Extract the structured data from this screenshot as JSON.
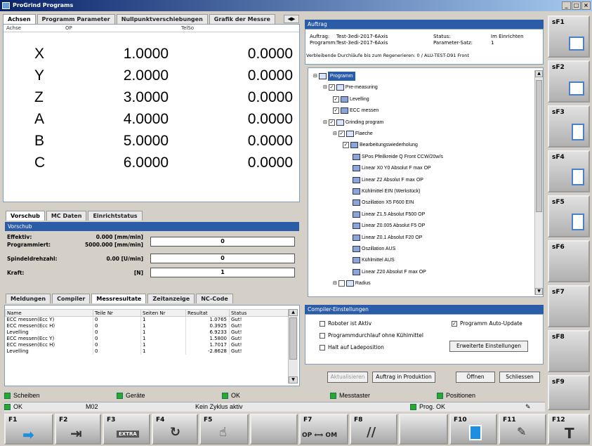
{
  "window": {
    "title": "ProGrind Programs"
  },
  "left_tabs": [
    "Achsen",
    "Programm Parameter",
    "Nullpunktverschiebungen",
    "Grafik der Messre"
  ],
  "axes_table": {
    "headers": [
      "Achse",
      "OP",
      "TelSo"
    ],
    "rows": [
      {
        "axis": "X",
        "op": "1.0000",
        "target": "0.0000"
      },
      {
        "axis": "Y",
        "op": "2.0000",
        "target": "0.0000"
      },
      {
        "axis": "Z",
        "op": "3.0000",
        "target": "0.0000"
      },
      {
        "axis": "A",
        "op": "4.0000",
        "target": "0.0000"
      },
      {
        "axis": "B",
        "op": "5.0000",
        "target": "0.0000"
      },
      {
        "axis": "C",
        "op": "6.0000",
        "target": "0.0000"
      }
    ]
  },
  "feed_tabs": [
    "Vorschub",
    "MC Daten",
    "Einrichtstatus"
  ],
  "feed": {
    "header": "Vorschub",
    "rows": [
      {
        "label": "Effektiv:",
        "value": "0.000 [mm/min]"
      },
      {
        "label": "Programmiert:",
        "value": "5000.000 [mm/min]",
        "box": "0"
      },
      {
        "label": "Spindeldrehzahl:",
        "value": "0.00 [U/min]",
        "box": "0"
      },
      {
        "label": "Kraft:",
        "value": "[N]",
        "box": "1"
      }
    ]
  },
  "bottom_tabs": [
    "Meldungen",
    "Compiler",
    "Messresultate",
    "Zeitanzeige",
    "NC-Code"
  ],
  "measure_table": {
    "headers": [
      "Name",
      "Teile Nr",
      "Seiten Nr",
      "Resultat",
      "Status"
    ],
    "rows": [
      [
        "ECC messen(Ecc Y)",
        "0",
        "1",
        "1.0765",
        "Gut!"
      ],
      [
        "ECC messen(Ecc H)",
        "0",
        "1",
        "0.3925",
        "Gut!"
      ],
      [
        "Levelling",
        "0",
        "1",
        "6.9233",
        "Gut!"
      ],
      [
        "ECC messen(Ecc Y)",
        "0",
        "1",
        "1.5800",
        "Gut!"
      ],
      [
        "ECC messen(Ecc H)",
        "0",
        "1",
        "1.7017",
        "Gut!"
      ],
      [
        "Levelling",
        "0",
        "1",
        "-2.8628",
        "Gut!"
      ]
    ]
  },
  "order": {
    "header": "Auftrag",
    "auftrag_label": "Auftrag:",
    "auftrag_value": "Test-3edi-2017-6Axis",
    "programm_label": "Programm:",
    "programm_value": "Test-3edi-2017-6Axis",
    "status_label": "Status:",
    "status_value": "Im Einrichten",
    "paramset_label": "Parameter-Satz:",
    "paramset_value": "1",
    "cycles_text": "Verbleibende Durchläufe bis zum Regenerieren: 0 / ALU-TEST-D91 Front"
  },
  "tree": [
    {
      "label": "Programm",
      "level": 0,
      "selected": true,
      "kind": "folder"
    },
    {
      "label": "Pre-measuring",
      "level": 1,
      "checked": true,
      "kind": "folder"
    },
    {
      "label": "Levelling",
      "level": 2,
      "checked": true,
      "kind": "op"
    },
    {
      "label": "ECC messen",
      "level": 2,
      "checked": true,
      "kind": "op"
    },
    {
      "label": "Grinding program",
      "level": 1,
      "checked": true,
      "kind": "folder"
    },
    {
      "label": "Flaeche",
      "level": 2,
      "checked": true,
      "kind": "folder"
    },
    {
      "label": "Bearbeitungswiederholung",
      "level": 3,
      "checked": true,
      "kind": "op"
    },
    {
      "label": "SPos Pfeilkreide Q Front CCW/20w/s",
      "level": 4,
      "kind": "op"
    },
    {
      "label": "Linear X0 Y0 Absolut F max OP",
      "level": 4,
      "kind": "op"
    },
    {
      "label": "Linear Z2 Absolut F max OP",
      "level": 4,
      "kind": "op"
    },
    {
      "label": "Kühlmittel EIN (Werkstück)",
      "level": 4,
      "kind": "op"
    },
    {
      "label": "Oszillation X5 F600 EIN",
      "level": 4,
      "kind": "op"
    },
    {
      "label": "Linear Z1.5 Absolut F500 OP",
      "level": 4,
      "kind": "op"
    },
    {
      "label": "Linear Z0.005 Absolut F5 OP",
      "level": 4,
      "kind": "op"
    },
    {
      "label": "Linear Z0.1 Absolut F20 OP",
      "level": 4,
      "kind": "op"
    },
    {
      "label": "Oszillation AUS",
      "level": 4,
      "kind": "op"
    },
    {
      "label": "Kühlmittel AUS",
      "level": 4,
      "kind": "op"
    },
    {
      "label": "Linear Z20 Absolut F max OP",
      "level": 4,
      "kind": "op"
    },
    {
      "label": "Radius",
      "level": 2,
      "checked": false,
      "kind": "folder"
    }
  ],
  "compiler": {
    "header": "Compiler-Einstellungen",
    "roboter": "Roboter ist Aktiv",
    "auto_update": "Programm Auto-Update",
    "ohne_kuehl": "Programmdurchlauf ohne Kühlmittel",
    "halt": "Halt auf Ladeposition",
    "advanced_btn": "Erweiterte Einstellungen"
  },
  "order_buttons": {
    "aktualisieren": "Aktualisieren",
    "produktion": "Auftrag in Produktion",
    "oeffnen": "Öffnen",
    "schliessen": "Schliessen"
  },
  "status1": {
    "scheiben": "Scheiben",
    "geraete": "Geräte",
    "ok1": "OK",
    "messtaster": "Messtaster",
    "positionen": "Positionen"
  },
  "status2": {
    "ok": "OK",
    "m02": "M02",
    "zyklus": "Kein Zyklus aktiv",
    "prog_ok": "Prog. OK"
  },
  "side_keys": [
    "sF1",
    "sF2",
    "sF3",
    "sF4",
    "sF5",
    "sF6",
    "sF7",
    "sF8",
    "sF9"
  ],
  "fkeys": {
    "f1": "F1",
    "f2": "F2",
    "f3": "F3",
    "f3_sub": "EXTRA",
    "f4": "F4",
    "f5": "F5",
    "f7": "F7",
    "f7_sub": "OP ⟺ OM",
    "f8": "F8",
    "f10": "F10",
    "f11": "F11",
    "f12": "F12"
  },
  "colors": {
    "accent": "#2a5ca8",
    "led": "#2ba82b",
    "titlebar": "#0a246a"
  }
}
